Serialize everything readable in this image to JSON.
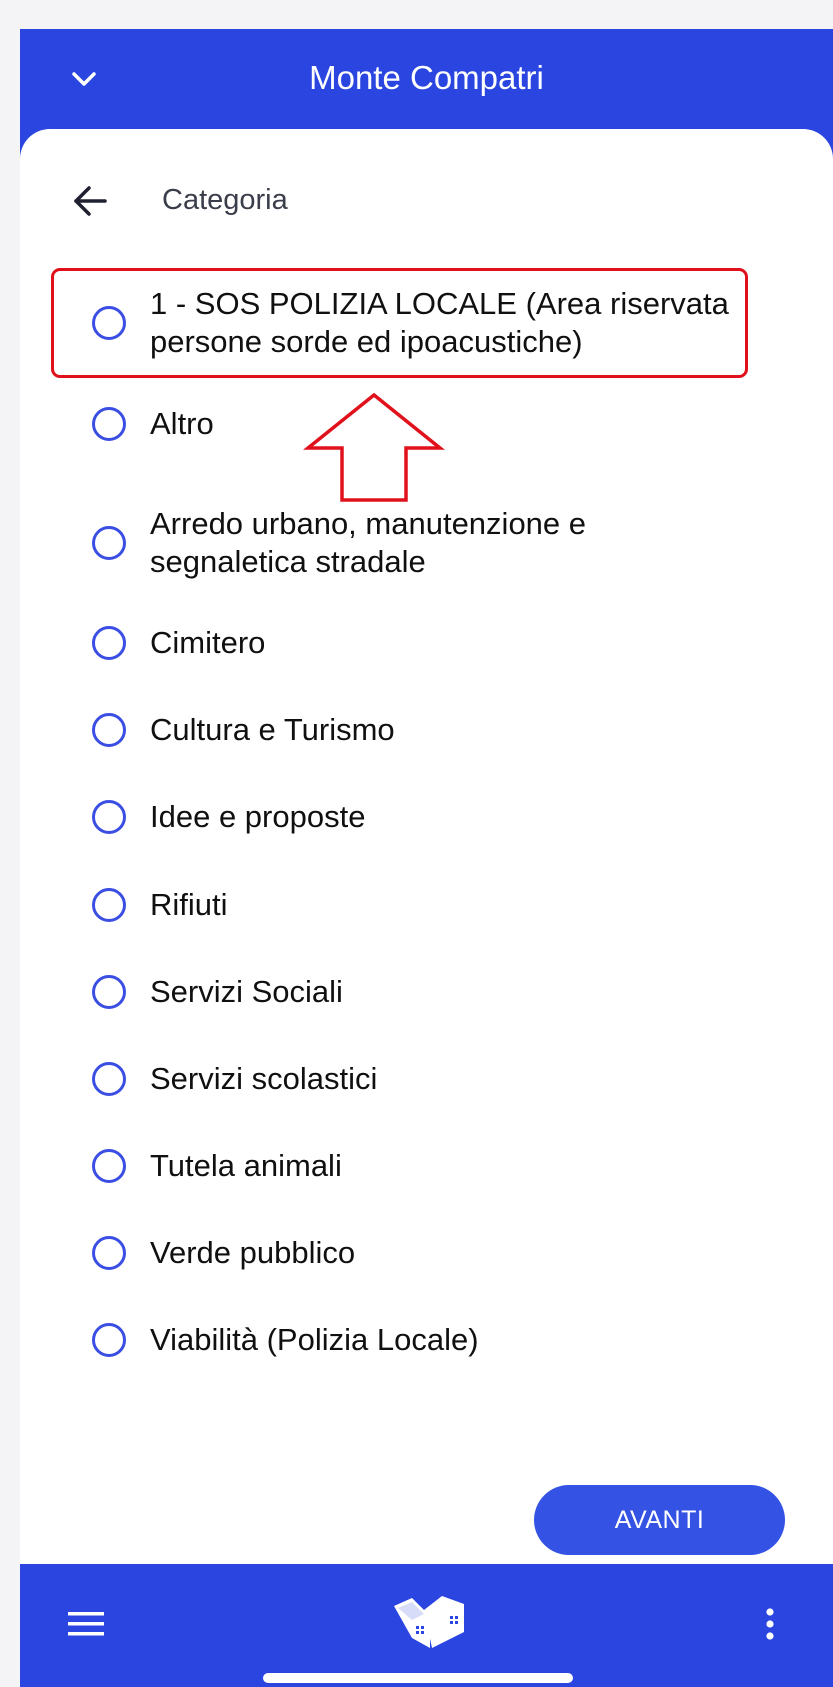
{
  "header": {
    "title": "Monte Compatri",
    "collapse_icon": "chevron-down-icon"
  },
  "sheet": {
    "title": "Categoria",
    "back_icon": "arrow-left-icon"
  },
  "categories": [
    "1 - SOS POLIZIA LOCALE (Area riservata persone sorde ed ipoacustiche)",
    "Altro",
    "Arredo urbano, manutenzione e segnaletica stradale",
    "Cimitero",
    "Cultura e Turismo",
    "Idee e proposte",
    "Rifiuti",
    "Servizi Sociali",
    "Servizi scolastici",
    "Tutela animali",
    "Verde pubblico",
    "Viabilità (Polizia Locale)"
  ],
  "next_button": {
    "label": "AVANTI"
  },
  "bottom_bar": {
    "menu_icon": "hamburger-menu-icon",
    "logo": "app-logo-icon",
    "more_icon": "more-vertical-icon"
  },
  "colors": {
    "primary": "#2a45e0",
    "button": "#3452e4",
    "radio": "#3b4ee3",
    "annotation": "#e0111b"
  }
}
